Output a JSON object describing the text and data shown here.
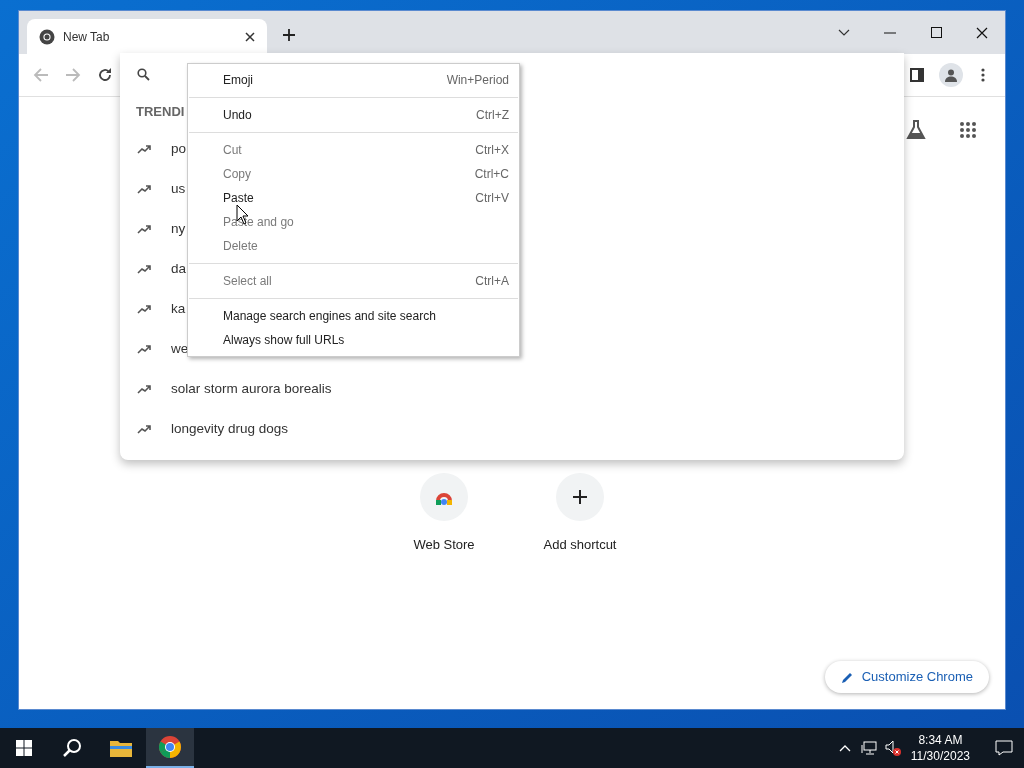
{
  "browser": {
    "tabs": [
      {
        "title": "New Tab",
        "selected": true
      }
    ]
  },
  "omnibox_dropdown": {
    "heading": "TRENDI",
    "suggestions": [
      "po",
      "us",
      "ny",
      "da",
      "ka",
      "we",
      "solar storm aurora borealis",
      "longevity drug dogs"
    ]
  },
  "context_menu": {
    "groups": [
      [
        {
          "label": "Emoji",
          "shortcut": "Win+Period",
          "disabled": false
        }
      ],
      [
        {
          "label": "Undo",
          "shortcut": "Ctrl+Z",
          "disabled": false
        }
      ],
      [
        {
          "label": "Cut",
          "shortcut": "Ctrl+X",
          "disabled": true
        },
        {
          "label": "Copy",
          "shortcut": "Ctrl+C",
          "disabled": true
        },
        {
          "label": "Paste",
          "shortcut": "Ctrl+V",
          "disabled": false
        },
        {
          "label": "Paste and go",
          "disabled": true
        },
        {
          "label": "Delete",
          "disabled": true
        }
      ],
      [
        {
          "label": "Select all",
          "shortcut": "Ctrl+A",
          "disabled": true
        }
      ],
      [
        {
          "label": "Manage search engines and site search",
          "disabled": false
        },
        {
          "label": "Always show full URLs",
          "disabled": false
        }
      ]
    ]
  },
  "shortcuts": [
    {
      "label": "Web Store",
      "kind": "webstore"
    },
    {
      "label": "Add shortcut",
      "kind": "add"
    }
  ],
  "customize_button": "Customize Chrome",
  "taskbar": {
    "time": "8:34 AM",
    "date": "11/30/2023"
  }
}
